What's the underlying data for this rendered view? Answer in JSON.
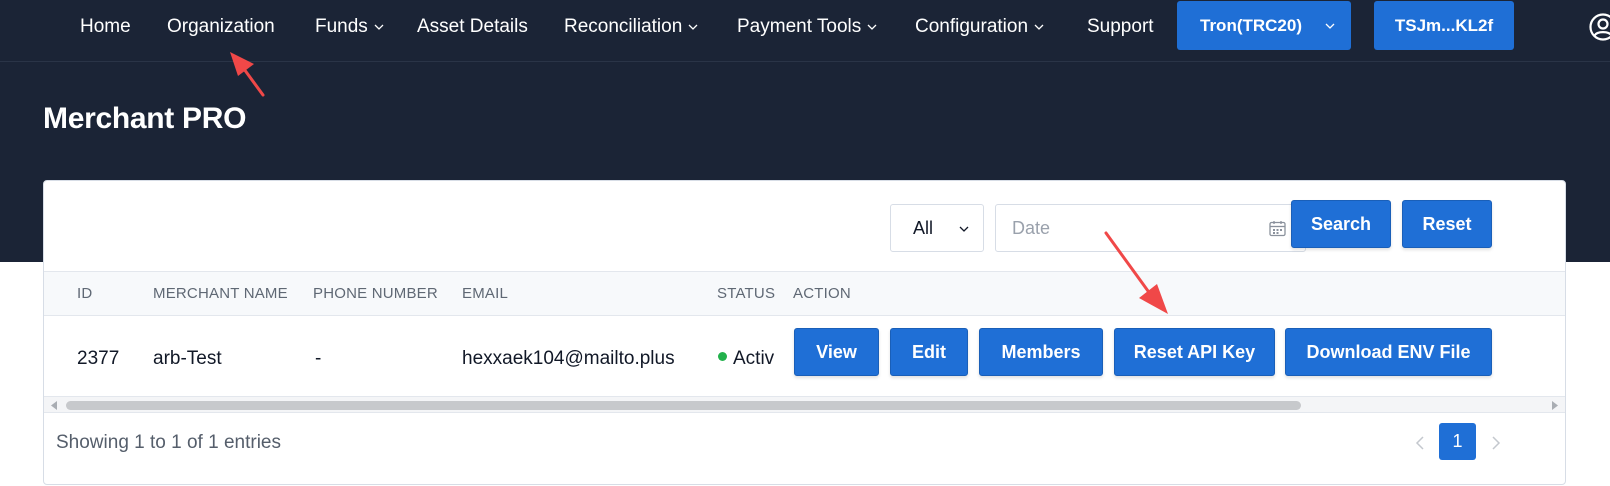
{
  "nav": {
    "items": [
      {
        "label": "Home",
        "dropdown": false
      },
      {
        "label": "Organization",
        "dropdown": false
      },
      {
        "label": "Funds",
        "dropdown": true
      },
      {
        "label": "Asset Details",
        "dropdown": false
      },
      {
        "label": "Reconciliation",
        "dropdown": true
      },
      {
        "label": "Payment Tools",
        "dropdown": true
      },
      {
        "label": "Configuration",
        "dropdown": true
      },
      {
        "label": "Support",
        "dropdown": false
      }
    ],
    "network_button": "Tron(TRC20)",
    "wallet_button": "TSJm...KL2f",
    "user_icon": "user-circle-icon"
  },
  "page": {
    "title": "Merchant PRO"
  },
  "filters": {
    "status_select": "All",
    "date_placeholder": "Date",
    "search_label": "Search",
    "reset_label": "Reset"
  },
  "table": {
    "columns": [
      "ID",
      "MERCHANT NAME",
      "PHONE NUMBER",
      "EMAIL",
      "STATUS",
      "ACTION"
    ],
    "rows": [
      {
        "id": "2377",
        "merchant_name": "arb-Test",
        "phone_number": "-",
        "email": "hexxaek104@mailto.plus",
        "status": "Activ",
        "actions": [
          "View",
          "Edit",
          "Members",
          "Reset API Key",
          "Download ENV File"
        ]
      }
    ]
  },
  "footer": {
    "showing_text": "Showing 1 to 1 of 1 entries",
    "current_page": "1"
  },
  "colors": {
    "header_bg": "#1b2436",
    "accent": "#1f6fd6",
    "status_active": "#22b14c",
    "annotation_arrow": "#f04848"
  }
}
